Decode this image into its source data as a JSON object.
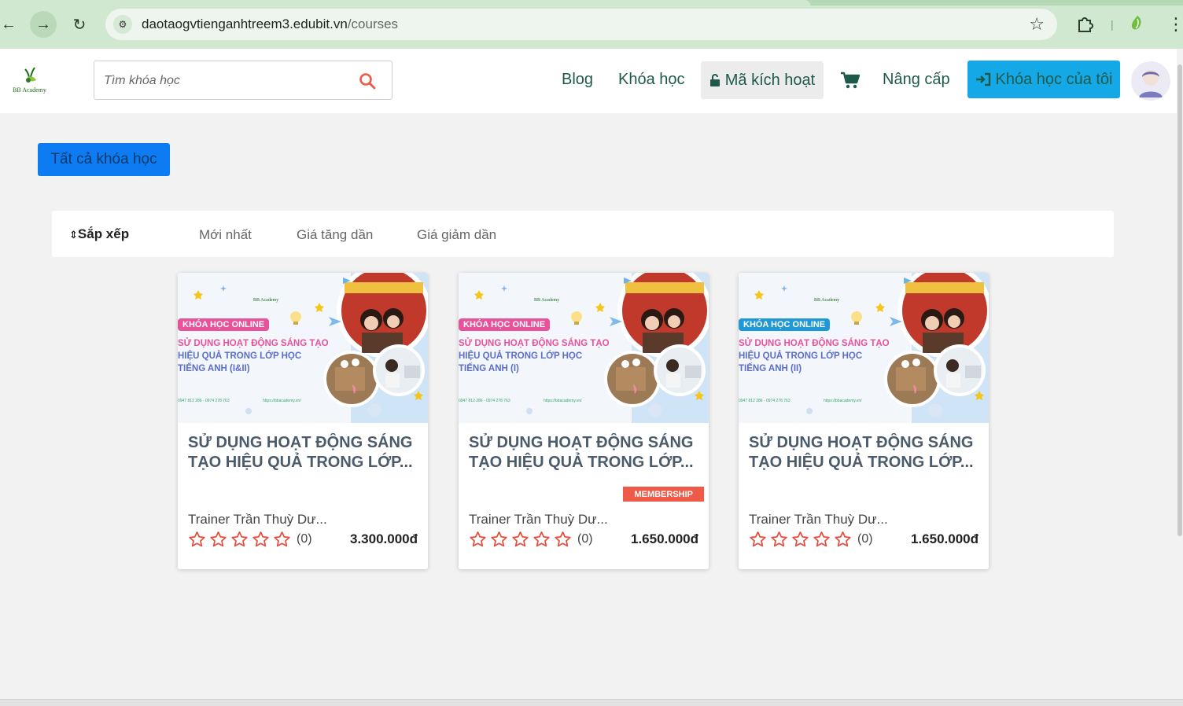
{
  "browser": {
    "url_host": "daotaogvtienganhtreem3.edubit.vn",
    "url_path": "/courses",
    "colors": {
      "frame": "#cfe8cf",
      "omnibox": "#eef5ee"
    }
  },
  "header": {
    "logo_text": "BB Academy",
    "search_placeholder": "Tìm khóa học",
    "nav": {
      "blog": "Blog",
      "courses": "Khóa học",
      "activation_code": "Mã kích hoạt",
      "upgrade": "Nâng cấp",
      "my_courses": "Khóa học của tôi"
    },
    "colors": {
      "nav_text": "#1e5a4a",
      "my_courses_bg": "#14a8e6"
    }
  },
  "main": {
    "all_courses_label": "Tất cả khóa học",
    "sort": {
      "label": "Sắp xếp",
      "options": [
        "Mới nhất",
        "Giá tăng dần",
        "Giá giảm dần"
      ]
    },
    "courses": [
      {
        "thumbnail": {
          "brand": "BB Academy",
          "badge": "KHÓA HỌC ONLINE",
          "badge_color": "#e8529b",
          "lines": [
            "SỬ DỤNG HOẠT ĐỘNG SÁNG TẠO",
            "HIỆU QUẢ TRONG LỚP HỌC",
            "TIẾNG ANH (I&II)"
          ],
          "contact": "0947 812 286 - 0974 278 763",
          "website": "https://bbacademy.vn/"
        },
        "title": "SỬ DỤNG HOẠT ĐỘNG SÁNG TẠO HIỆU QUẢ TRONG LỚP...",
        "membership": "",
        "trainer": "Trainer Trần Thuỳ Dư...",
        "rating": 0,
        "review_count": "(0)",
        "price": "3.300.000đ"
      },
      {
        "thumbnail": {
          "brand": "BB Academy",
          "badge": "KHÓA HỌC ONLINE",
          "badge_color": "#e8529b",
          "lines": [
            "SỬ DỤNG HOẠT ĐỘNG SÁNG TẠO",
            "HIỆU QUẢ TRONG LỚP HỌC",
            "TIẾNG ANH (I)"
          ],
          "contact": "0947 812 286 - 0974 278 763",
          "website": "https://bbacademy.vn/"
        },
        "title": "SỬ DỤNG HOẠT ĐỘNG SÁNG TẠO HIỆU QUẢ TRONG LỚP...",
        "membership": "MEMBERSHIP",
        "trainer": "Trainer Trần Thuỳ Dư...",
        "rating": 0,
        "review_count": "(0)",
        "price": "1.650.000đ"
      },
      {
        "thumbnail": {
          "brand": "BB Academy",
          "badge": "KHÓA HỌC ONLINE",
          "badge_color": "#1f98d6",
          "lines": [
            "SỬ DỤNG HOẠT ĐỘNG SÁNG TẠO",
            "HIỆU QUẢ TRONG LỚP HỌC",
            "TIẾNG ANH (II)"
          ],
          "contact": "0947 812 286 - 0974 278 763",
          "website": "https://bbacademy.vn/"
        },
        "title": "SỬ DỤNG HOẠT ĐỘNG SÁNG TẠO HIỆU QUẢ TRONG LỚP...",
        "membership": "",
        "trainer": "Trainer Trần Thuỳ Dư...",
        "rating": 0,
        "review_count": "(0)",
        "price": "1.650.000đ"
      }
    ],
    "colors": {
      "primary_button": "#0d7cf2",
      "membership": "#ee5a47",
      "star": "#e74c3c",
      "title": "#4c5b6b"
    }
  },
  "icons": [
    "back-arrow-icon",
    "forward-arrow-icon",
    "reload-icon",
    "site-settings-icon",
    "bookmark-star-icon",
    "extensions-icon",
    "profile-icon",
    "menu-dots-icon",
    "search-icon",
    "lock-icon",
    "cart-icon",
    "sign-in-icon",
    "sort-icon",
    "star-outline-icon"
  ]
}
